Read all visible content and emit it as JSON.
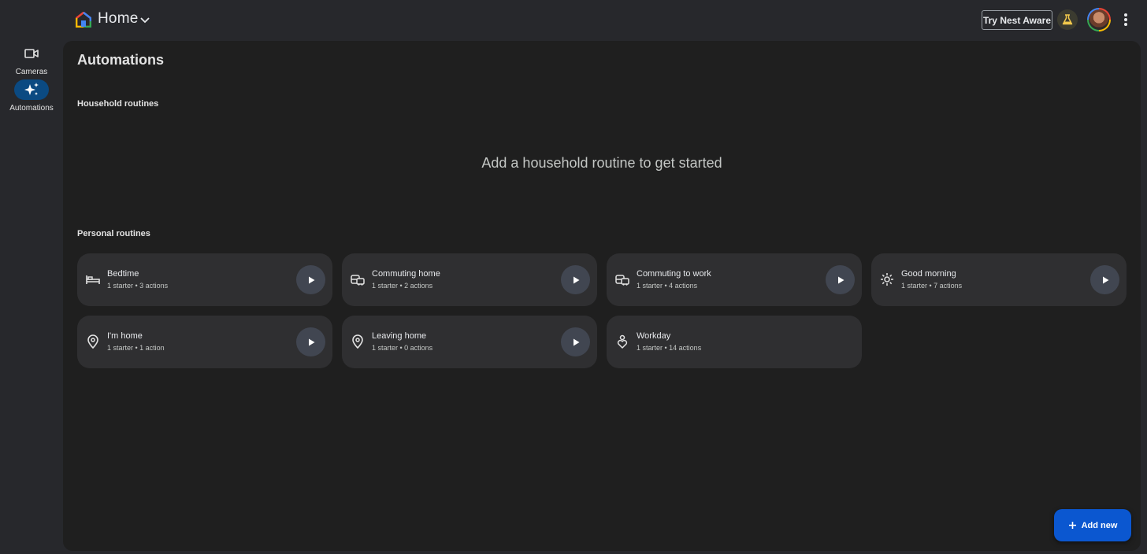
{
  "header": {
    "home_label": "Home",
    "nest_aware_button": "Try Nest Aware",
    "icons": [
      "home-logo-icon",
      "chevron-down-icon",
      "labs-flask-icon",
      "avatar",
      "more-vert-icon"
    ]
  },
  "sidebar": {
    "items": [
      {
        "label": "Cameras",
        "icon": "videocam-icon",
        "active": false
      },
      {
        "label": "Automations",
        "icon": "sparkle-icon",
        "active": true
      }
    ]
  },
  "main": {
    "title": "Automations",
    "household": {
      "title": "Household routines",
      "empty_message": "Add a household routine to get started"
    },
    "personal": {
      "title": "Personal routines",
      "routines": [
        {
          "name": "Bedtime",
          "meta": "1 starter • 3 actions",
          "icon": "bed-icon",
          "playable": true
        },
        {
          "name": "Commuting home",
          "meta": "1 starter • 2 actions",
          "icon": "commute-icon",
          "playable": true
        },
        {
          "name": "Commuting to work",
          "meta": "1 starter • 4 actions",
          "icon": "commute-icon",
          "playable": true
        },
        {
          "name": "Good morning",
          "meta": "1 starter • 7 actions",
          "icon": "sunrise-icon",
          "playable": true
        },
        {
          "name": "I'm home",
          "meta": "1 starter • 1 action",
          "icon": "location-pin-icon",
          "playable": true
        },
        {
          "name": "Leaving home",
          "meta": "1 starter • 0 actions",
          "icon": "location-pin-icon",
          "playable": true
        },
        {
          "name": "Workday",
          "meta": "1 starter • 14 actions",
          "icon": "workday-icon",
          "playable": false
        }
      ]
    }
  },
  "fab": {
    "label": "Add new",
    "icon": "plus-icon"
  },
  "colors": {
    "background": "#27282c",
    "surface": "#1f1f1f",
    "card": "#2f2f31",
    "active_nav": "#0b4a82",
    "fab": "#0b57d0",
    "play_button": "#414651"
  }
}
